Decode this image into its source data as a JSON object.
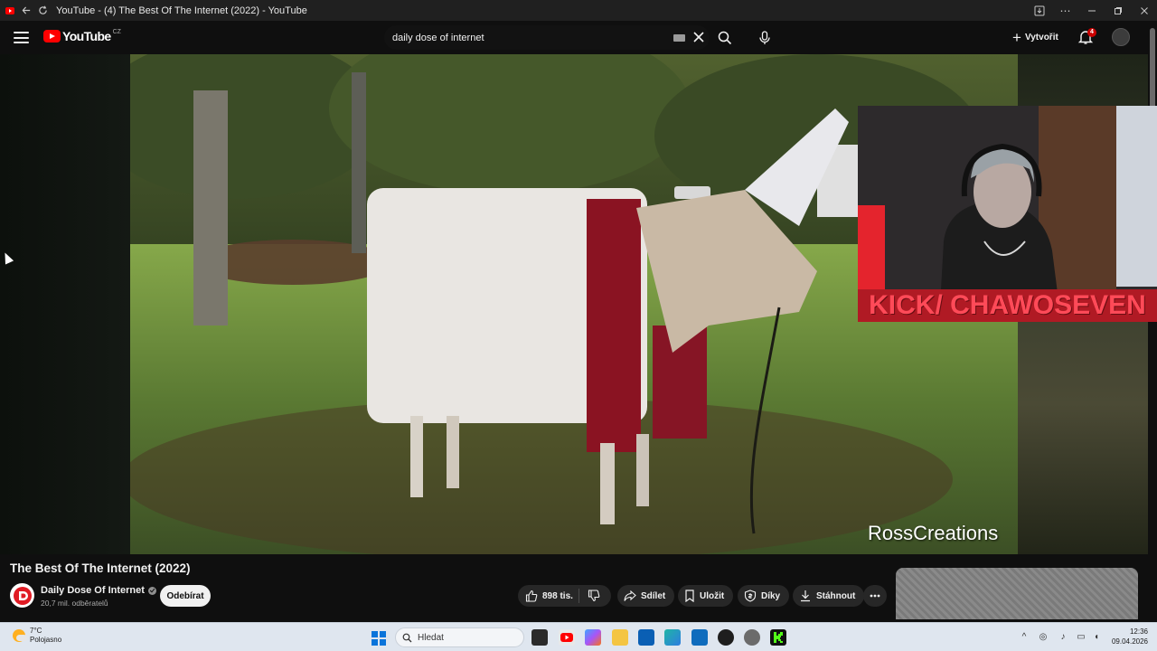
{
  "browser": {
    "window_title": "YouTube - (4) The Best Of The Internet (2022) - YouTube"
  },
  "header": {
    "logo_text": "YouTube",
    "country_code": "CZ",
    "search_value": "daily dose of internet",
    "create_label": "Vytvořit",
    "notification_count": "4"
  },
  "video": {
    "overlay_text": "KICK/ CHAWOSEVEN",
    "watermark": "RossCreations",
    "title": "The Best Of The Internet (2022)"
  },
  "channel": {
    "name": "Daily Dose Of Internet",
    "subscribers": "20,7 mil. odběratelů",
    "subscribe_label": "Odebírat"
  },
  "actions": {
    "like_count": "898 tis.",
    "share_label": "Sdílet",
    "save_label": "Uložit",
    "thanks_label": "Díky",
    "download_label": "Stáhnout"
  },
  "taskbar": {
    "weather_temp": "7°C",
    "weather_desc": "Polojasno",
    "search_placeholder": "Hledat",
    "time": "12:36",
    "date": "09.04.2026"
  },
  "colors": {
    "brand_red": "#ff0000",
    "kick_banner": "#b01a24",
    "background": "#0f0f0f"
  }
}
